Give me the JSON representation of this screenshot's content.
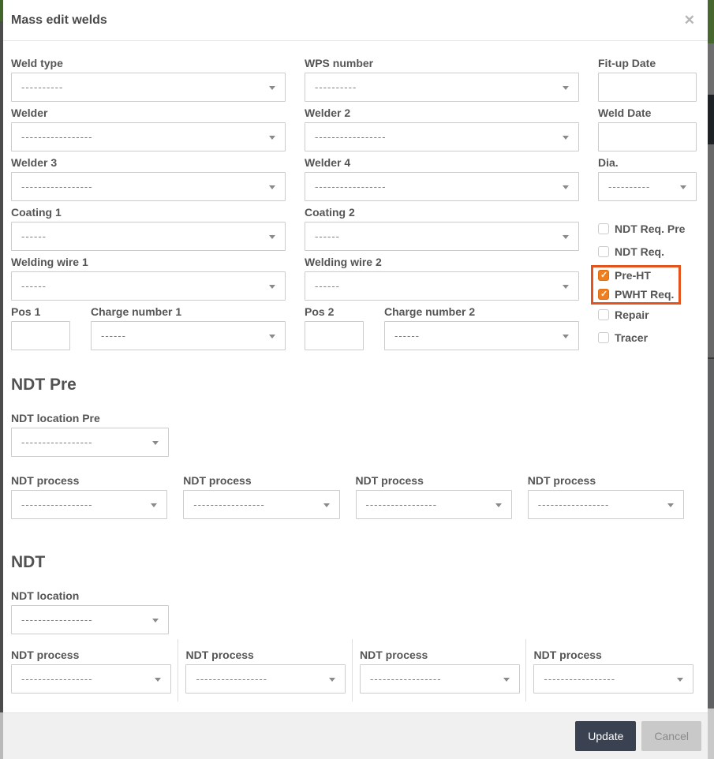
{
  "modal": {
    "title": "Mass edit welds",
    "close_icon": "✕"
  },
  "form": {
    "weld_type": {
      "label": "Weld type",
      "value": "----------"
    },
    "wps_number": {
      "label": "WPS number",
      "value": "----------"
    },
    "fit_up_date": {
      "label": "Fit-up Date",
      "value": ""
    },
    "welder": {
      "label": "Welder",
      "value": "-----------------"
    },
    "welder2": {
      "label": "Welder 2",
      "value": "-----------------"
    },
    "weld_date": {
      "label": "Weld Date",
      "value": ""
    },
    "welder3": {
      "label": "Welder 3",
      "value": "-----------------"
    },
    "welder4": {
      "label": "Welder 4",
      "value": "-----------------"
    },
    "dia": {
      "label": "Dia.",
      "value": "----------"
    },
    "coating1": {
      "label": "Coating 1",
      "value": "------"
    },
    "coating2": {
      "label": "Coating 2",
      "value": "------"
    },
    "welding_wire1": {
      "label": "Welding wire 1",
      "value": "------"
    },
    "welding_wire2": {
      "label": "Welding wire 2",
      "value": "------"
    },
    "pos1": {
      "label": "Pos 1",
      "value": ""
    },
    "charge_number1": {
      "label": "Charge number 1",
      "value": "------"
    },
    "pos2": {
      "label": "Pos 2",
      "value": ""
    },
    "charge_number2": {
      "label": "Charge number 2",
      "value": "------"
    }
  },
  "checkboxes": [
    {
      "label": "NDT Req. Pre",
      "checked": false
    },
    {
      "label": "NDT Req.",
      "checked": false
    },
    {
      "label": "Pre-HT",
      "checked": true,
      "highlighted": true
    },
    {
      "label": "PWHT Req.",
      "checked": true,
      "highlighted": true
    },
    {
      "label": "Repair",
      "checked": false
    },
    {
      "label": "Tracer",
      "checked": false
    }
  ],
  "ndt_pre": {
    "heading": "NDT Pre",
    "location": {
      "label": "NDT location Pre",
      "value": "-----------------"
    },
    "processes": [
      {
        "label": "NDT process",
        "value": "-----------------"
      },
      {
        "label": "NDT process",
        "value": "-----------------"
      },
      {
        "label": "NDT process",
        "value": "-----------------"
      },
      {
        "label": "NDT process",
        "value": "-----------------"
      }
    ]
  },
  "ndt": {
    "heading": "NDT",
    "location": {
      "label": "NDT location",
      "value": "-----------------"
    },
    "processes": [
      {
        "label": "NDT process",
        "value": "-----------------"
      },
      {
        "label": "NDT process",
        "value": "-----------------"
      },
      {
        "label": "NDT process",
        "value": "-----------------"
      },
      {
        "label": "NDT process",
        "value": "-----------------"
      }
    ]
  },
  "footer": {
    "update_label": "Update",
    "cancel_label": "Cancel"
  },
  "colors": {
    "highlight_box": "#e4531b",
    "checkbox_checked": "#ee7e1e",
    "update_button": "#3a4150"
  }
}
